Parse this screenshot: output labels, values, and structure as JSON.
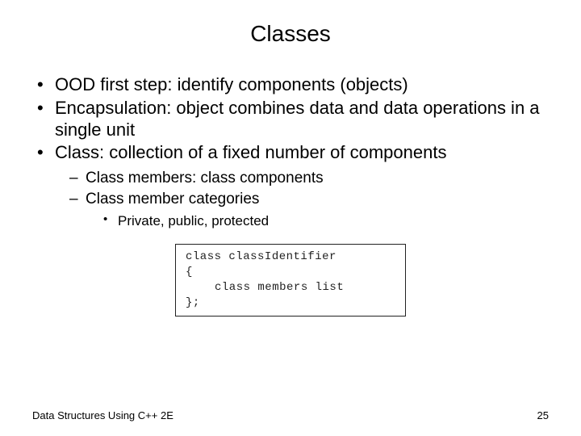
{
  "title": "Classes",
  "bullets": {
    "b1": "OOD first step: identify components (objects)",
    "b2": "Encapsulation: object combines data and data operations in a single unit",
    "b3": "Class: collection of a fixed number of components",
    "b3_1": "Class members: class components",
    "b3_2": "Class member categories",
    "b3_2_1": "Private, public, protected"
  },
  "code": {
    "line1": "class classIdentifier",
    "line2": "{",
    "line3": "class members list",
    "line4": "};"
  },
  "footer": {
    "left": "Data Structures Using C++ 2E",
    "right": "25"
  }
}
